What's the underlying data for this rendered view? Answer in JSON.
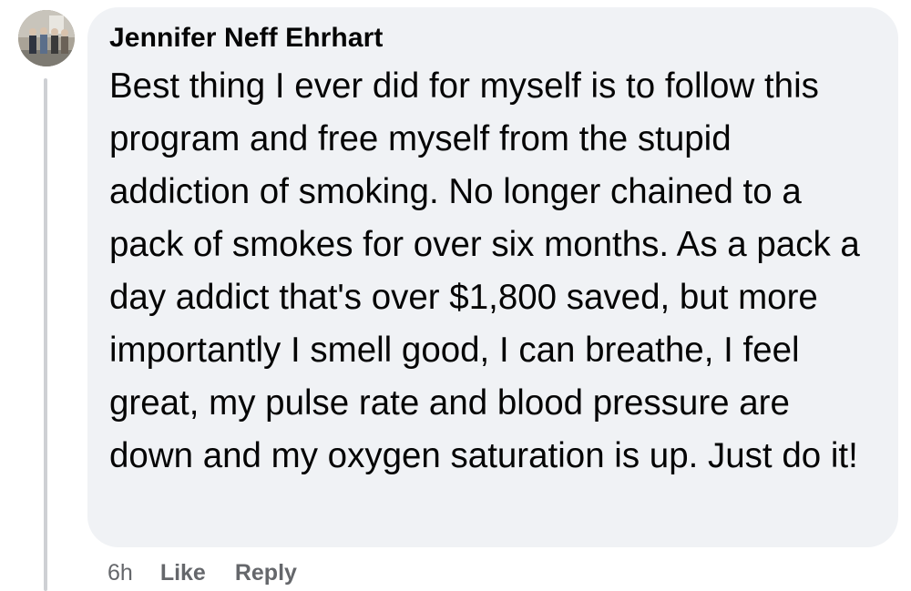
{
  "comment": {
    "author": "Jennifer Neff Ehrhart",
    "text": "Best thing I ever did for myself is to follow this program and free myself from the stupid addiction of smoking. No longer chained to a pack of smokes for over six months. As a pack a day addict that's over $1,800 saved, but more importantly I smell good, I can breathe, I feel great, my pulse rate and blood pressure are down and my oxygen saturation is up. Just do it!",
    "time": "6h",
    "like_label": "Like",
    "reply_label": "Reply"
  },
  "colors": {
    "bubble_bg": "#f0f2f5",
    "text": "#050505",
    "secondary_text": "#65676b",
    "thread_line": "#ced0d4"
  }
}
